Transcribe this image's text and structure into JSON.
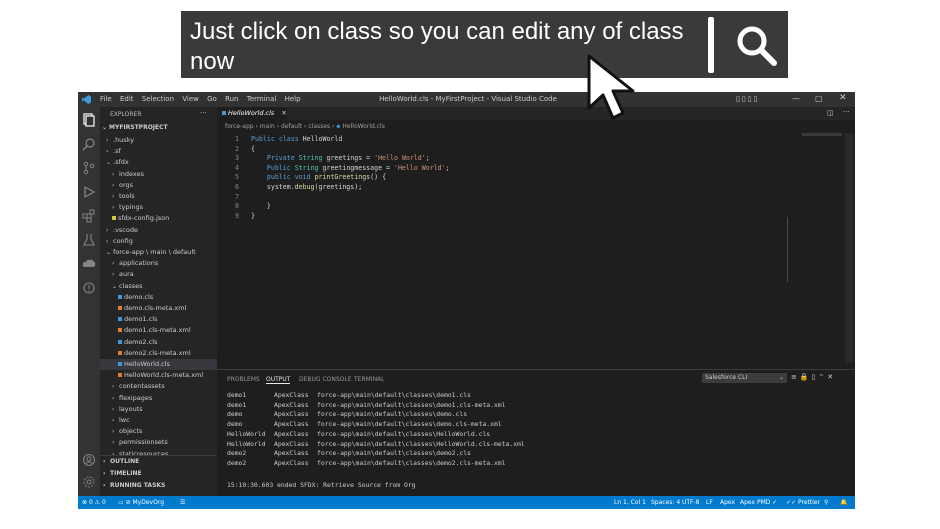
{
  "banner": {
    "text": "Just click on class so you can edit any of class now",
    "search_icon": "search-icon",
    "pointer_icon": "arrow-cursor-icon"
  },
  "titlebar": {
    "menus": [
      "File",
      "Edit",
      "Selection",
      "View",
      "Go",
      "Run",
      "Terminal",
      "Help"
    ],
    "title": "HelloWorld.cls - MyFirstProject - Visual Studio Code"
  },
  "sidebar": {
    "header": "EXPLORER",
    "project": "MYFIRSTPROJECT",
    "items": [
      {
        "label": ".husky",
        "type": "folder",
        "level": 1,
        "open": false
      },
      {
        "label": ".sf",
        "type": "folder",
        "level": 1,
        "open": false
      },
      {
        "label": ".sfdx",
        "type": "folder",
        "level": 1,
        "open": true
      },
      {
        "label": "indexes",
        "type": "folder",
        "level": 2,
        "open": false
      },
      {
        "label": "orgs",
        "type": "folder",
        "level": 2,
        "open": false
      },
      {
        "label": "tools",
        "type": "folder",
        "level": 2,
        "open": false
      },
      {
        "label": "typings",
        "type": "folder",
        "level": 2,
        "open": false
      },
      {
        "label": "sfdx-config.json",
        "type": "json",
        "level": 2
      },
      {
        "label": ".vscode",
        "type": "folder",
        "level": 1,
        "open": false
      },
      {
        "label": "config",
        "type": "folder",
        "level": 1,
        "open": false
      },
      {
        "label": "force-app \\ main \\ default",
        "type": "folder",
        "level": 1,
        "open": true
      },
      {
        "label": "applications",
        "type": "folder",
        "level": 2,
        "open": false
      },
      {
        "label": "aura",
        "type": "folder",
        "level": 2,
        "open": false
      },
      {
        "label": "classes",
        "type": "folder",
        "level": 2,
        "open": true
      },
      {
        "label": "demo.cls",
        "type": "cls",
        "level": 3
      },
      {
        "label": "demo.cls-meta.xml",
        "type": "xml",
        "level": 3
      },
      {
        "label": "demo1.cls",
        "type": "cls",
        "level": 3
      },
      {
        "label": "demo1.cls-meta.xml",
        "type": "xml",
        "level": 3
      },
      {
        "label": "demo2.cls",
        "type": "cls",
        "level": 3
      },
      {
        "label": "demo2.cls-meta.xml",
        "type": "xml",
        "level": 3
      },
      {
        "label": "HelloWorld.cls",
        "type": "cls",
        "level": 3,
        "selected": true
      },
      {
        "label": "HelloWorld.cls-meta.xml",
        "type": "xml",
        "level": 3
      },
      {
        "label": "contentassets",
        "type": "folder",
        "level": 2,
        "open": false
      },
      {
        "label": "flexipages",
        "type": "folder",
        "level": 2,
        "open": false
      },
      {
        "label": "layouts",
        "type": "folder",
        "level": 2,
        "open": false
      },
      {
        "label": "lwc",
        "type": "folder",
        "level": 2,
        "open": false
      },
      {
        "label": "objects",
        "type": "folder",
        "level": 2,
        "open": false
      },
      {
        "label": "permissionsets",
        "type": "folder",
        "level": 2,
        "open": false
      },
      {
        "label": "staticresources",
        "type": "folder",
        "level": 2,
        "open": false
      }
    ],
    "sections": [
      "OUTLINE",
      "TIMELINE",
      "RUNNING TASKS"
    ]
  },
  "editor": {
    "tab": "HelloWorld.cls",
    "breadcrumb": [
      "force-app",
      "main",
      "default",
      "classes",
      "HelloWorld.cls"
    ],
    "lines": [
      {
        "n": "1",
        "code": "Public class HelloWorld"
      },
      {
        "n": "2",
        "code": "{"
      },
      {
        "n": "3",
        "code": "    Private String greetings = 'Hello World';"
      },
      {
        "n": "4",
        "code": "    Public String greetingmessage = 'Hello World';"
      },
      {
        "n": "5",
        "code": "    public void printGreetings() {"
      },
      {
        "n": "6",
        "code": "    system.debug(greetings);"
      },
      {
        "n": "7",
        "code": ""
      },
      {
        "n": "8",
        "code": "    }"
      },
      {
        "n": "9",
        "code": "}"
      }
    ]
  },
  "panel": {
    "tabs": [
      "PROBLEMS",
      "OUTPUT",
      "DEBUG CONSOLE",
      "TERMINAL"
    ],
    "active_tab": "OUTPUT",
    "channel": "Salesforce CLI",
    "rows": [
      {
        "name": "demo1",
        "type": "ApexClass",
        "path": "force-app\\main\\default\\classes\\demo1.cls"
      },
      {
        "name": "demo1",
        "type": "ApexClass",
        "path": "force-app\\main\\default\\classes\\demo1.cls-meta.xml"
      },
      {
        "name": "demo",
        "type": "ApexClass",
        "path": "force-app\\main\\default\\classes\\demo.cls"
      },
      {
        "name": "demo",
        "type": "ApexClass",
        "path": "force-app\\main\\default\\classes\\demo.cls-meta.xml"
      },
      {
        "name": "HelloWorld",
        "type": "ApexClass",
        "path": "force-app\\main\\default\\classes\\HelloWorld.cls"
      },
      {
        "name": "HelloWorld",
        "type": "ApexClass",
        "path": "force-app\\main\\default\\classes\\HelloWorld.cls-meta.xml"
      },
      {
        "name": "demo2",
        "type": "ApexClass",
        "path": "force-app\\main\\default\\classes\\demo2.cls"
      },
      {
        "name": "demo2",
        "type": "ApexClass",
        "path": "force-app\\main\\default\\classes\\demo2.cls-meta.xml"
      }
    ],
    "footer": "15:10:30.603 ended SFDX: Retrieve Source from Org"
  },
  "statusbar": {
    "errors": "0",
    "warnings": "0",
    "org": "MyDevOrg",
    "position": "Ln 1, Col 1",
    "spaces": "Spaces: 4",
    "encoding": "UTF-8",
    "eol": "LF",
    "language": "Apex",
    "pmd": "Apex PMD ✓",
    "prettier": "Prettier"
  },
  "colors": {
    "keyword": "#569cd6",
    "type": "#4ec9b0",
    "string": "#ce9178",
    "function": "#dcdcaa",
    "status": "#007acc",
    "banner": "#3a3a3a"
  }
}
